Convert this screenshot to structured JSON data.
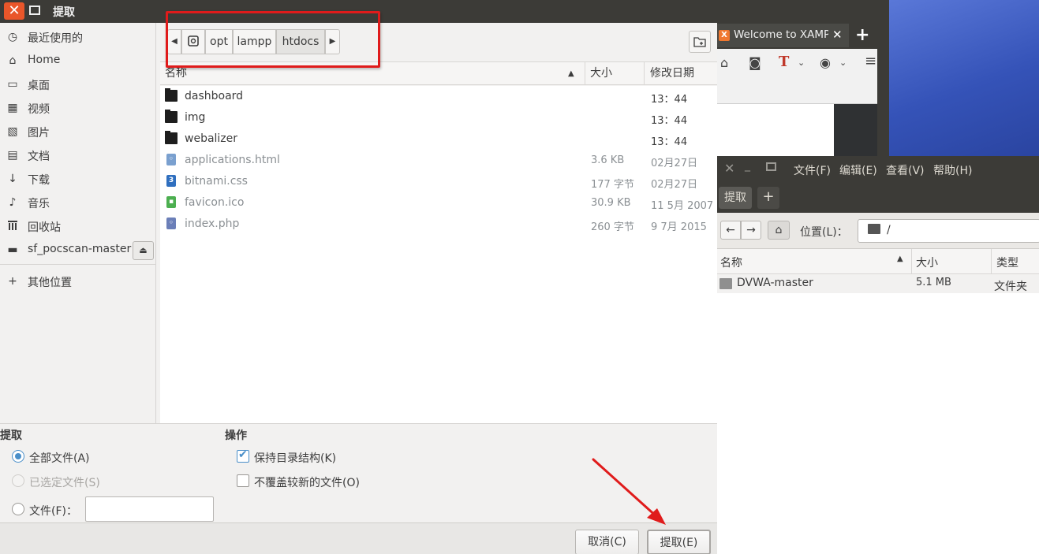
{
  "dialog": {
    "title": "提取"
  },
  "sidebar": {
    "items": [
      {
        "label": "最近使用的",
        "icon": "clock-icon",
        "glyph": "◷"
      },
      {
        "label": "Home",
        "icon": "home-icon",
        "glyph": "⌂"
      },
      {
        "label": "桌面",
        "icon": "desktop-icon",
        "glyph": "▭"
      },
      {
        "label": "视频",
        "icon": "video-icon",
        "glyph": "▦"
      },
      {
        "label": "图片",
        "icon": "picture-icon",
        "glyph": "▧"
      },
      {
        "label": "文档",
        "icon": "document-icon",
        "glyph": "▤"
      },
      {
        "label": "下载",
        "icon": "download-icon",
        "glyph": "↓"
      },
      {
        "label": "音乐",
        "icon": "music-icon",
        "glyph": "♪"
      },
      {
        "label": "回收站",
        "icon": "trash-icon",
        "glyph": "🗑"
      },
      {
        "label": "sf_pocscan-master",
        "icon": "drive-icon",
        "glyph": "▬"
      }
    ],
    "other_locations": "其他位置",
    "eject_glyph": "⏏"
  },
  "pathbar": {
    "crumbs": [
      "opt",
      "lampp",
      "htdocs"
    ],
    "active": "htdocs"
  },
  "file_table": {
    "columns": {
      "name": "名称",
      "size": "大小",
      "modified": "修改日期"
    },
    "rows": [
      {
        "name": "dashboard",
        "type": "folder",
        "size": "",
        "date": "13：44"
      },
      {
        "name": "img",
        "type": "folder",
        "size": "",
        "date": "13：44"
      },
      {
        "name": "webalizer",
        "type": "folder",
        "size": "",
        "date": "13：44"
      },
      {
        "name": "applications.html",
        "type": "html",
        "size": "3.6 KB",
        "date": "02月27日"
      },
      {
        "name": "bitnami.css",
        "type": "css",
        "size": "177 字节",
        "date": "02月27日"
      },
      {
        "name": "favicon.ico",
        "type": "ico",
        "size": "30.9 KB",
        "date": "11 5月 2007"
      },
      {
        "name": "index.php",
        "type": "php",
        "size": "260 字节",
        "date": "9 7月 2015"
      }
    ]
  },
  "extract_options": {
    "section_extract": "提取",
    "all_files": "全部文件(A)",
    "selected_files": "已选定文件(S)",
    "files_pattern": "文件(F)：",
    "section_actions": "操作",
    "keep_structure": "保持目录结构(K)",
    "no_overwrite": "不覆盖较新的文件(O)"
  },
  "buttons": {
    "cancel": "取消(C)",
    "extract": "提取(E)"
  },
  "browser": {
    "tab_title": "Welcome to XAMPP",
    "favicon": "X"
  },
  "file_manager": {
    "menu": [
      "文件(F)",
      "编辑(E)",
      "查看(V)",
      "帮助(H)"
    ],
    "tab_label": "提取",
    "location_label": "位置(L)：",
    "location_value": "/",
    "columns": {
      "name": "名称",
      "size": "大小",
      "type": "类型"
    },
    "rows": [
      {
        "name": "DVWA-master",
        "size": "5.1 MB",
        "type": "文件夹"
      }
    ]
  },
  "colors": {
    "accent": "#4a8fc9",
    "close_button": "#e9562a",
    "annotation_red": "#e01b1b",
    "titlebar": "#3c3b37"
  }
}
